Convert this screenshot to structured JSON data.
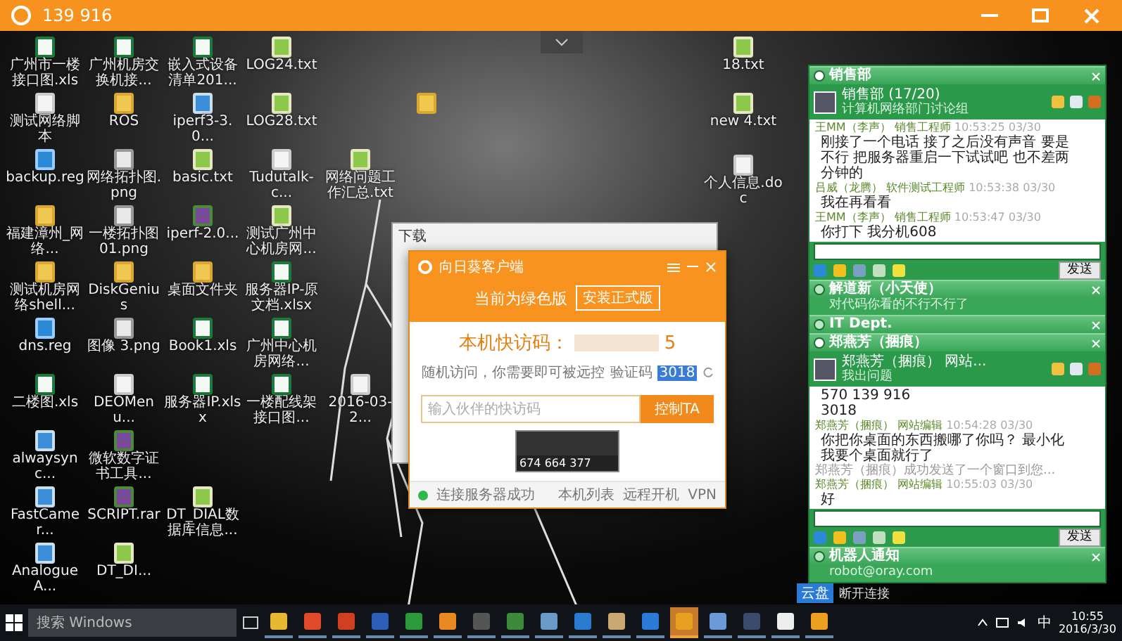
{
  "window": {
    "title": "139 916"
  },
  "desktop_rows": [
    [
      {
        "label": "广州市一楼接口图.xls",
        "kind": "excel"
      },
      {
        "label": "广州机房交换机接...",
        "kind": "excel"
      },
      {
        "label": "嵌入式设备清单201...",
        "kind": "excel"
      },
      {
        "label": "LOG24.txt",
        "kind": "text"
      }
    ],
    [
      {
        "label": "测试网络脚本",
        "kind": "file"
      },
      {
        "label": "ROS",
        "kind": "folder"
      },
      {
        "label": "iperf3-3.0...",
        "kind": "app"
      },
      {
        "label": "LOG28.txt",
        "kind": "text"
      }
    ],
    [
      {
        "label": "backup.reg",
        "kind": "reg"
      },
      {
        "label": "网络拓扑图.png",
        "kind": "image"
      },
      {
        "label": "basic.txt",
        "kind": "text"
      },
      {
        "label": "Tudutalk-c...",
        "kind": "file"
      },
      {
        "label": "网络问题工作汇总.txt",
        "kind": "text"
      }
    ],
    [
      {
        "label": "福建漳州_网络...",
        "kind": "folder"
      },
      {
        "label": "一楼拓扑图01.png",
        "kind": "image"
      },
      {
        "label": "iperf-2.0...",
        "kind": "archive"
      },
      {
        "label": "测试广州中心机房网...",
        "kind": "text"
      }
    ],
    [
      {
        "label": "测试机房网络shell...",
        "kind": "folder"
      },
      {
        "label": "DiskGenius",
        "kind": "folder"
      },
      {
        "label": "桌面文件夹",
        "kind": "folder"
      },
      {
        "label": "服务器IP-原文档.xlsx",
        "kind": "excel"
      }
    ],
    [
      {
        "label": "dns.reg",
        "kind": "reg"
      },
      {
        "label": "图像 3.png",
        "kind": "image"
      },
      {
        "label": "Book1.xls",
        "kind": "excel"
      },
      {
        "label": "广州中心机房网络...",
        "kind": "excel"
      }
    ],
    [
      {
        "label": "二楼图.xls",
        "kind": "excel"
      },
      {
        "label": "DEOMenu...",
        "kind": "file"
      },
      {
        "label": "服务器IP.xlsx",
        "kind": "excel"
      },
      {
        "label": "一楼配线架接口图...",
        "kind": "excel"
      },
      {
        "label": "2016-03-2...",
        "kind": "file"
      }
    ],
    [
      {
        "label": "alwaysync...",
        "kind": "app"
      },
      {
        "label": "微软数字证书工具...",
        "kind": "archive"
      }
    ],
    [
      {
        "label": "FastCamer...",
        "kind": "app"
      },
      {
        "label": "SCRIPT.rar",
        "kind": "archive"
      },
      {
        "label": "DT_DIAL数据库信息...",
        "kind": "text"
      }
    ],
    [
      {
        "label": "AnalogueA...",
        "kind": "app"
      },
      {
        "label": "DT_DI...",
        "kind": "text"
      }
    ]
  ],
  "loose_icons": [
    {
      "label": "18.txt",
      "kind": "text"
    },
    {
      "label": "new 4.txt",
      "kind": "text"
    },
    {
      "label": "个人信息.doc",
      "kind": "file"
    }
  ],
  "back_window": {
    "title": "下载"
  },
  "dialog": {
    "title": "向日葵客户端",
    "edition": "当前为绿色版",
    "install_button": "安装正式版",
    "code_label": "本机快访码：",
    "code_tail": "5",
    "hint": "随机访问，你需要即可被远控",
    "verify_label": "验证码",
    "verify_code": "3018",
    "input_placeholder": "输入伙伴的快访码",
    "control_button": "控制TA",
    "preview_code": "674 664 377",
    "status": "连接服务器成功",
    "footer_links": [
      "本机列表",
      "远程开机",
      "VPN"
    ]
  },
  "chat": {
    "groups": [
      {
        "title": "销售部",
        "expanded": true,
        "contact": {
          "name": "销售部 (17/20)",
          "status": "计算机网络部门讨论组"
        },
        "messages": [
          {
            "kind": "meta",
            "sender": "王MM（李声） 销售工程师",
            "time": "10:53:25 03/30"
          },
          {
            "kind": "text",
            "text": "刚接了一个电话 接了之后没有声音  要是不行 把服务器重启一下试试吧  也不差两分钟的"
          },
          {
            "kind": "meta",
            "sender": "吕威（龙腾） 软件测试工程师",
            "time": "10:53:38 03/30"
          },
          {
            "kind": "text",
            "text": "我在再看看"
          },
          {
            "kind": "meta",
            "sender": "王MM（李声） 销售工程师",
            "time": "10:53:47 03/30"
          },
          {
            "kind": "text",
            "text": "你打下 我分机608"
          }
        ],
        "send": "发送"
      },
      {
        "title": "解道新（小天使）",
        "subtitle": "对代码你看的不行不行了",
        "expanded": false
      },
      {
        "title": "IT Dept.",
        "expanded": false
      },
      {
        "title": "郑燕芳（捆痕）",
        "expanded": true,
        "contact": {
          "name": "郑燕芳（捆痕） 网站...",
          "status": "我出问题"
        },
        "messages": [
          {
            "kind": "text",
            "text": "570 139 916"
          },
          {
            "kind": "text",
            "text": "3018"
          },
          {
            "kind": "meta",
            "sender": "郑燕芳（捆痕） 网站编辑",
            "time": "10:54:28 03/30"
          },
          {
            "kind": "text",
            "text": "你把你桌面的东西搬哪了你吗？ 最小化"
          },
          {
            "kind": "text",
            "text": "我要个桌面就行了"
          },
          {
            "kind": "info",
            "text": "郑燕芳（捆痕）成功发送了一个窗口到您..."
          },
          {
            "kind": "meta",
            "sender": "郑燕芳（捆痕） 网站编辑",
            "time": "10:55:03 03/30"
          },
          {
            "kind": "text",
            "text": "好"
          }
        ],
        "send": "发送"
      },
      {
        "title": "机器人通知",
        "subtitle": "robot@oray.com",
        "expanded": false
      }
    ]
  },
  "cloud_bar": {
    "label": "云盘",
    "action": "断开连接"
  },
  "taskbar": {
    "search_placeholder": "搜索 Windows",
    "apps": [
      {
        "selected": false
      },
      {
        "selected": false
      },
      {
        "selected": false
      },
      {
        "selected": false
      },
      {
        "selected": false
      },
      {
        "selected": false
      },
      {
        "selected": false
      },
      {
        "selected": false
      },
      {
        "selected": false
      },
      {
        "selected": false
      },
      {
        "selected": false
      },
      {
        "selected": false
      },
      {
        "selected": true
      },
      {
        "selected": false
      },
      {
        "selected": false
      },
      {
        "selected": false
      },
      {
        "selected": false
      }
    ],
    "ime": "中",
    "time": "10:55",
    "date": "2016/3/30"
  }
}
